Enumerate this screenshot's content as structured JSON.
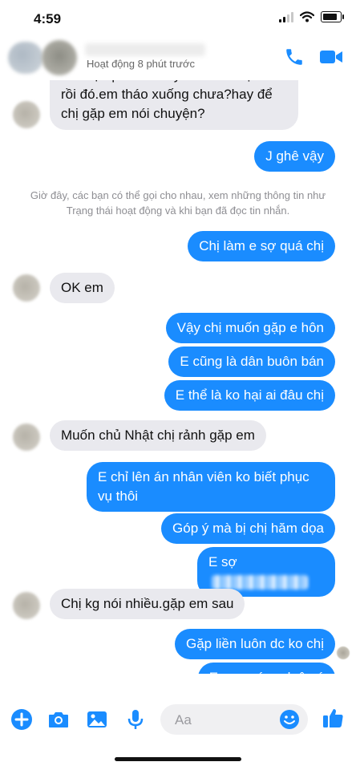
{
  "status_bar": {
    "time": "4:59"
  },
  "header": {
    "activity": "Hoạt động 8 phút trước"
  },
  "messages": {
    "m1": "Em hại quán mi cay của em chị đủ rồi đó.em tháo xuống chưa?hay để chị gặp em nói chuyện?",
    "m2": "J ghê vậy",
    "system_note": "Giờ đây, các bạn có thể gọi cho nhau, xem những thông tin như Trạng thái hoạt động và khi bạn đã đọc tin nhắn.",
    "m3": "Chị làm e sợ quá chị",
    "m4": "OK em",
    "m5": "Vậy chị muốn gặp e hôn",
    "m6": "E cũng là dân buôn bán",
    "m7": "E thể là ko hại ai đâu chị",
    "m8": "Muốn chủ Nhật chị rảnh gặp em",
    "m9": "E chỉ lên án nhân viên ko biết phục vụ thôi",
    "m10": "Góp ý mà bị chị hăm dọa",
    "m11": "E sợ",
    "m12": "Chị kg nói nhiều.gặp em sau",
    "m13": "Gặp liền luôn dc ko chị",
    "m14": "E sợ quá sợ luôn ý"
  },
  "composer": {
    "placeholder": "Aa"
  },
  "colors": {
    "accent": "#1a8cff",
    "incoming_bubble": "#e9e9ee"
  },
  "icons": [
    "plus-icon",
    "camera-icon",
    "image-icon",
    "mic-icon",
    "emoji-icon",
    "like-icon",
    "phone-icon",
    "video-icon"
  ]
}
